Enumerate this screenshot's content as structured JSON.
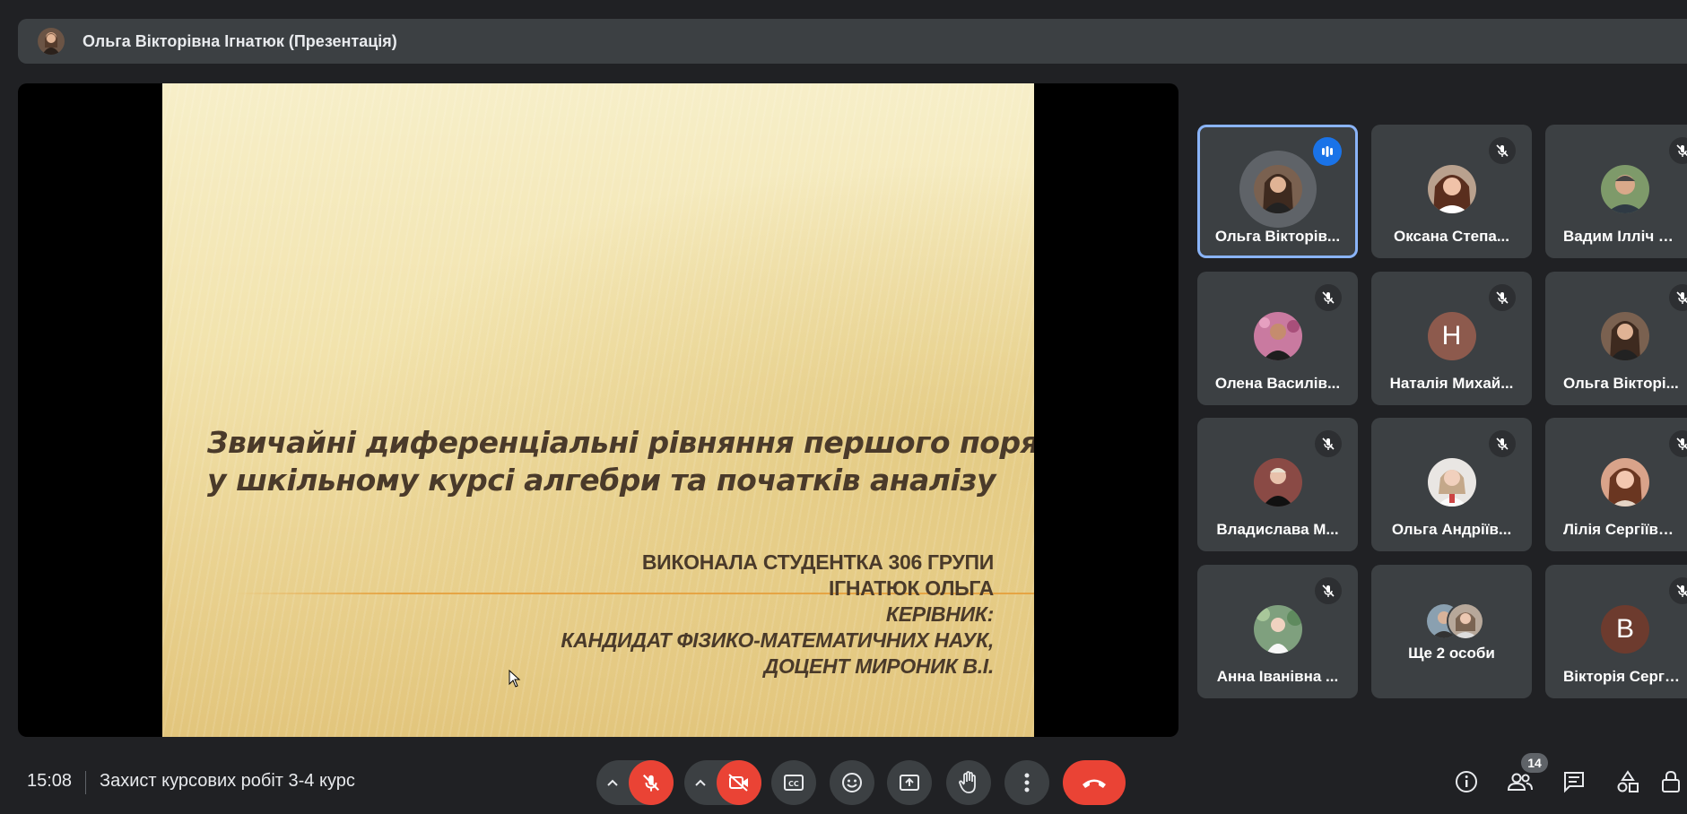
{
  "presenter_bar": {
    "title": "Ольга Вікторівна Ігнатюк (Презентація)"
  },
  "slide": {
    "title_line1": "Звичайні диференціальні рівняння першого порядку",
    "title_line2": "у шкільному курсі алгебри та початків аналізу",
    "author_line1": "ВИКОНАЛА СТУДЕНТКА 306 ГРУПИ",
    "author_line2": "ІГНАТЮК ОЛЬГА",
    "author_line3": "КЕРІВНИК:",
    "author_line4": "КАНДИДАТ ФІЗИКО-МАТЕМАТИЧНИХ НАУК,",
    "author_line5": "ДОЦЕНТ МИРОНИК В.І."
  },
  "participants": [
    {
      "name": "Ольга Вікторів...",
      "status": "speaking"
    },
    {
      "name": "Оксана Степа...",
      "status": "muted"
    },
    {
      "name": "Вадим Ілліч М...",
      "status": "muted"
    },
    {
      "name": "Олена Василів...",
      "status": "muted"
    },
    {
      "name": "Наталія Михай...",
      "status": "muted",
      "initial": "Н",
      "color": "#8d5a4d"
    },
    {
      "name": "Ольга Вікторі...",
      "status": "muted"
    },
    {
      "name": "Владислава М...",
      "status": "muted"
    },
    {
      "name": "Ольга Андріїв...",
      "status": "muted"
    },
    {
      "name": "Лілія Сергіївн...",
      "status": "muted"
    },
    {
      "name": "Анна Іванівна ...",
      "status": "muted"
    },
    {
      "name": "Ще 2 особи",
      "status": "none"
    },
    {
      "name": "Вікторія Сергі...",
      "status": "muted",
      "initial": "В",
      "color": "#6d3b2e"
    }
  ],
  "bottom_bar": {
    "time": "15:08",
    "meeting_name": "Захист курсових робіт 3-4 курс",
    "participants_count": "14"
  },
  "colors": {
    "end_call": "#ea4335",
    "active_border": "#8ab4f8",
    "speaking": "#1a73e8"
  }
}
